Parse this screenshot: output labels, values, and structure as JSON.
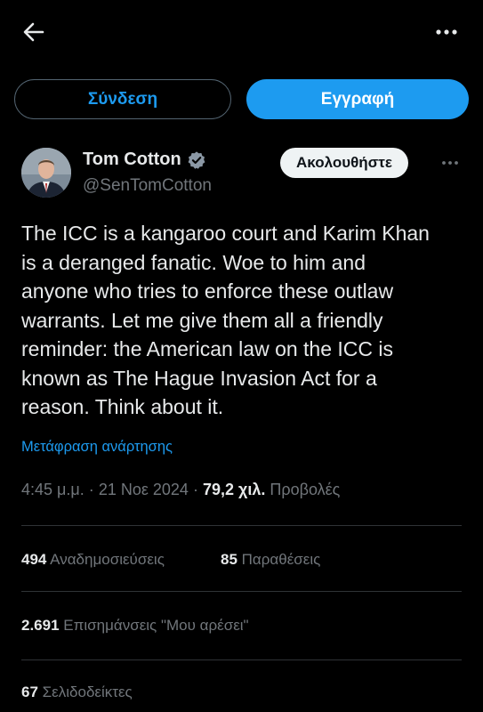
{
  "header": {
    "back_icon": "arrow-left-icon",
    "more_icon": "more-horizontal-icon"
  },
  "auth": {
    "login_label": "Σύνδεση",
    "signup_label": "Εγγραφή"
  },
  "author": {
    "name": "Tom Cotton",
    "handle": "@SenTomCotton",
    "verified_icon": "verified-badge-icon",
    "follow_label": "Ακολουθήστε"
  },
  "tweet": {
    "lines": [
      "The ICC is a kangaroo court and Karim Khan",
      "is a deranged fanatic. Woe to him and",
      "anyone who tries to enforce these outlaw",
      "warrants. Let me give them all a friendly",
      "reminder: the American law on the ICC is",
      "known as The Hague Invasion Act for a",
      "reason. Think about it."
    ],
    "translate_label": "Μετάφραση ανάρτησης"
  },
  "meta": {
    "time": "4:45 μ.μ.",
    "separator": "·",
    "date": "21 Νοε 2024",
    "views_count": "79,2 χιλ.",
    "views_label": "Προβολές"
  },
  "stats": {
    "reposts_count": "494",
    "reposts_label": "Αναδημοσιεύσεις",
    "quotes_count": "85",
    "quotes_label": "Παραθέσεις",
    "likes_count": "2.691",
    "likes_label": "Επισημάνσεις \"Μου αρέσει\"",
    "bookmarks_count": "67",
    "bookmarks_label": "Σελιδοδείκτες"
  },
  "colors": {
    "accent": "#1d9bf0",
    "background": "#000000",
    "text": "#e7e9ea",
    "muted": "#71767b",
    "divider": "#2f3336"
  }
}
